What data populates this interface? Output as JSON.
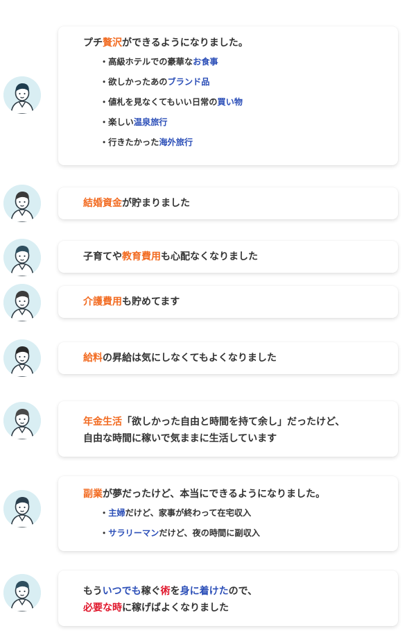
{
  "testimonials": [
    {
      "lines": [
        [
          {
            "t": "プチ"
          },
          {
            "t": "贅沢",
            "c": "o"
          },
          {
            "t": "ができるようになりました。"
          }
        ]
      ],
      "items": [
        [
          {
            "t": "・高級ホテルでの豪華な"
          },
          {
            "t": "お食事",
            "c": "b"
          }
        ],
        [
          {
            "t": "・欲しかったあの"
          },
          {
            "t": "ブランド品",
            "c": "b"
          }
        ],
        [
          {
            "t": "・値札を見なくてもいい日常の"
          },
          {
            "t": "買い物",
            "c": "b"
          }
        ],
        [
          {
            "t": "・楽しい"
          },
          {
            "t": "温泉旅行",
            "c": "b"
          }
        ],
        [
          {
            "t": "・行きたかった"
          },
          {
            "t": "海外旅行",
            "c": "b"
          }
        ]
      ]
    },
    {
      "lines": [
        [
          {
            "t": "結婚資金",
            "c": "o"
          },
          {
            "t": "が貯まりました"
          }
        ]
      ],
      "items": []
    },
    {
      "lines": [
        [
          {
            "t": "子育てや"
          },
          {
            "t": "教育費用",
            "c": "o"
          },
          {
            "t": "も心配なくなりました"
          }
        ]
      ],
      "items": []
    },
    {
      "lines": [
        [
          {
            "t": "介護費用",
            "c": "o"
          },
          {
            "t": "も貯めてます"
          }
        ]
      ],
      "items": []
    },
    {
      "lines": [
        [
          {
            "t": "給料",
            "c": "o"
          },
          {
            "t": "の昇給は気にしなくてもよくなりました"
          }
        ]
      ],
      "items": []
    },
    {
      "lines": [
        [
          {
            "t": "年金生活",
            "c": "o"
          },
          {
            "t": "「欲しかった自由と時間を持て余し」だったけど、"
          }
        ],
        [
          {
            "t": "自由な時間に稼いで気ままに生活しています"
          }
        ]
      ],
      "items": []
    },
    {
      "lines": [
        [
          {
            "t": "副業",
            "c": "o"
          },
          {
            "t": "が夢だったけど、本当にできるようになりました。"
          }
        ]
      ],
      "items": [
        [
          {
            "t": "・"
          },
          {
            "t": "主婦",
            "c": "b"
          },
          {
            "t": "だけど、家事が終わって在宅収入"
          }
        ],
        [
          {
            "t": "・"
          },
          {
            "t": "サラリーマン",
            "c": "b"
          },
          {
            "t": "だけど、夜の時間に副収入"
          }
        ]
      ]
    },
    {
      "lines": [
        [
          {
            "t": "もう"
          },
          {
            "t": "いつでも",
            "c": "b"
          },
          {
            "t": "稼ぐ"
          },
          {
            "t": "術",
            "c": "r"
          },
          {
            "t": "を"
          },
          {
            "t": "身に着けた",
            "c": "b"
          },
          {
            "t": "ので、"
          }
        ],
        [
          {
            "t": "必要な時",
            "c": "r"
          },
          {
            "t": "に稼げばよくなりました"
          }
        ]
      ],
      "items": []
    }
  ],
  "colors": {
    "orange": "#f26b21",
    "blue": "#2c4fb8",
    "red": "#e0162b",
    "text": "#333333",
    "avatar_bg": "#d9eef3"
  }
}
